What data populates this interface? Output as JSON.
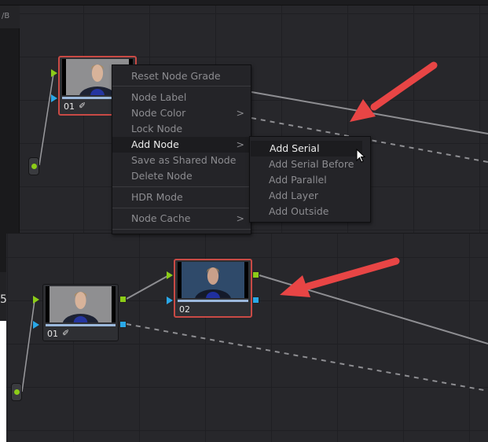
{
  "left_panel": {
    "header": "/B",
    "value": "5"
  },
  "context_menu": {
    "items": [
      {
        "label": "Reset Node Grade"
      },
      {
        "label": "Node Label"
      },
      {
        "label": "Node Color",
        "submenu": true
      },
      {
        "label": "Lock Node"
      },
      {
        "label": "Add Node",
        "submenu": true,
        "highlighted": true
      },
      {
        "label": "Save as Shared Node"
      },
      {
        "label": "Delete Node"
      },
      {
        "label": "HDR Mode"
      },
      {
        "label": "Node Cache",
        "submenu": true
      }
    ],
    "chevron": ">"
  },
  "submenu": {
    "items": [
      {
        "label": "Add Serial",
        "highlighted": true
      },
      {
        "label": "Add Serial Before"
      },
      {
        "label": "Add Parallel"
      },
      {
        "label": "Add Layer"
      },
      {
        "label": "Add Outside"
      }
    ]
  },
  "nodes": {
    "top_01": "01",
    "bottom_01": "01",
    "bottom_02": "02"
  },
  "icons": {
    "picker": "eyedropper-icon",
    "cursor": "mouse-pointer-icon",
    "arrow": "annotation-arrow"
  },
  "colors": {
    "accent_selected": "#c94a45",
    "rgb_port": "#8ccc18",
    "alpha_port": "#2aa8e8",
    "annotation": "#e84545"
  }
}
